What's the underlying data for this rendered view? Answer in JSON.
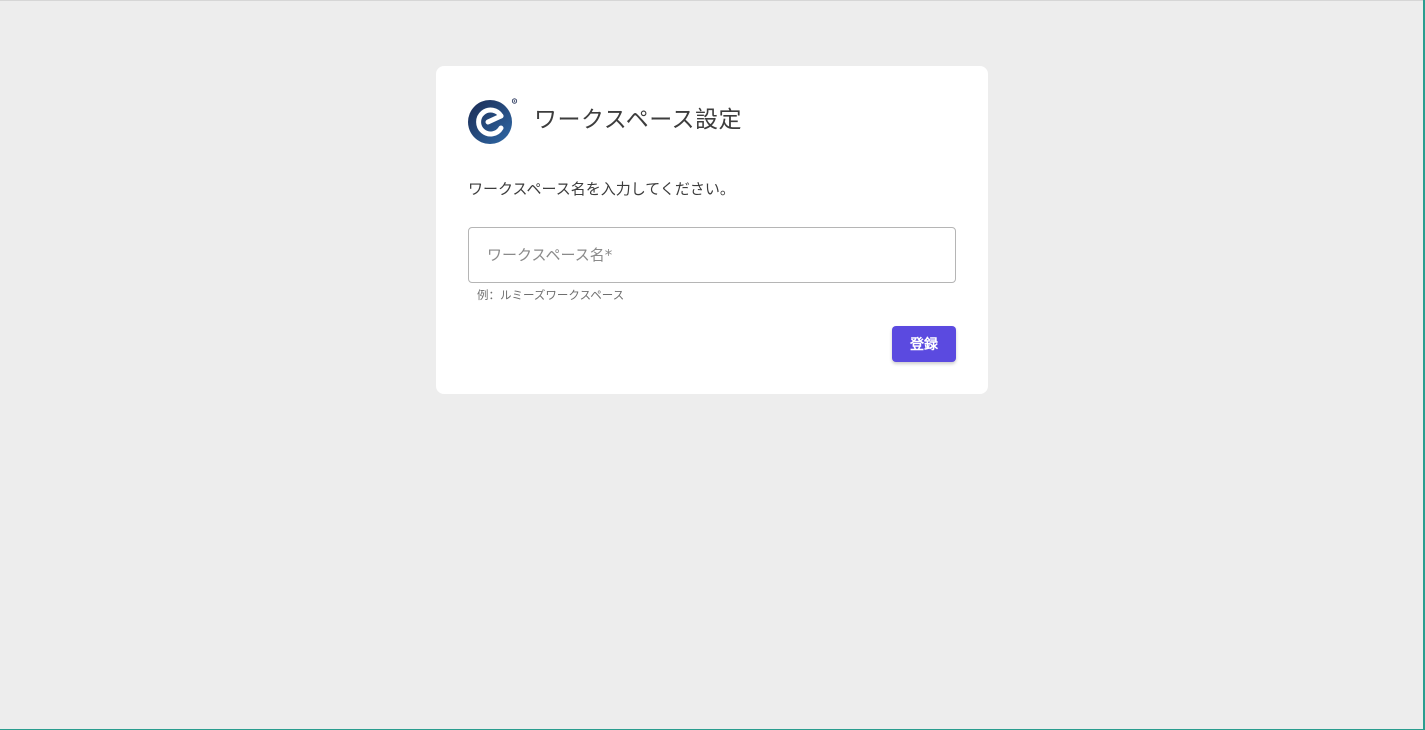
{
  "card": {
    "title": "ワークスペース設定",
    "instruction": "ワークスペース名を入力してください。",
    "workspace_name": {
      "placeholder": "ワークスペース名*",
      "value": "",
      "hint": "例：ルミーズワークスペース"
    },
    "submit_label": "登録"
  },
  "colors": {
    "background": "#ededed",
    "card": "#ffffff",
    "primary_button": "#5b4ae0",
    "logo_dark": "#1b2a52",
    "logo_light": "#2f6aa8"
  },
  "icons": {
    "logo": "brand-logo-icon"
  }
}
